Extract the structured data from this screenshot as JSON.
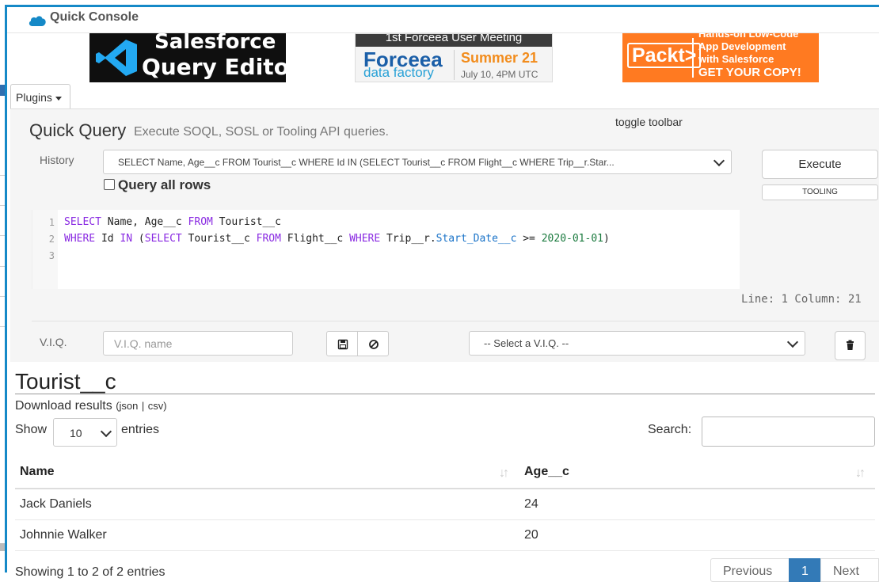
{
  "window": {
    "title": "Quick Console"
  },
  "banners": {
    "editor": {
      "line1": "Salesforce",
      "line2": "Query Editor"
    },
    "forceea": {
      "meeting": "1st Forceea User Meeting",
      "brand": "Forceea",
      "sub": "data factory",
      "season": "Summer 21",
      "date": "July 10, 4PM UTC"
    },
    "packt": {
      "logo": "Packt>",
      "line1": "Hands-on Low-Code",
      "line2": "App Development",
      "line3": "with Salesforce",
      "line4": "GET YOUR COPY!"
    }
  },
  "plugins": {
    "label": "Plugins"
  },
  "quick_query": {
    "title": "Quick Query",
    "description": "Execute SOQL, SOSL or Tooling API queries.",
    "toggle_toolbar": "toggle toolbar",
    "history_label": "History",
    "history_value": "SELECT Name, Age__c FROM Tourist__c WHERE Id IN (SELECT Tourist__c FROM Flight__c WHERE Trip__r.Star...",
    "query_all_rows": "Query all rows",
    "execute": "Execute",
    "tooling": "TOOLING"
  },
  "editor": {
    "line_numbers": [
      "1",
      "2",
      "3"
    ],
    "line1": {
      "kw1": "SELECT",
      "t1": " Name, Age__c ",
      "kw2": "FROM",
      "t2": " Tourist__c"
    },
    "line2": {
      "kw1": "WHERE",
      "t1": " Id ",
      "kw2": "IN",
      "t2": " (",
      "kw3": "SELECT",
      "t3": " Tourist__c ",
      "kw4": "FROM",
      "t4": " Flight__c ",
      "kw5": "WHERE",
      "t5": " Trip__r.",
      "field": "Start_Date__c",
      "t6": " >= ",
      "num": "2020-01-01",
      "t7": ")"
    },
    "status": "Line: 1 Column: 21"
  },
  "viq": {
    "label": "V.I.Q.",
    "name_placeholder": "V.I.Q. name",
    "select_value": "-- Select a V.I.Q. --"
  },
  "results": {
    "title": "Tourist__c",
    "download_label": "Download results",
    "open_paren": "(",
    "json": "json",
    "sep": "|",
    "csv": "csv",
    "close_paren": ")",
    "show_label": "Show",
    "entries_value": "10",
    "entries_label": "entries",
    "search_label": "Search:",
    "columns": [
      "Name",
      "Age__c"
    ],
    "rows": [
      [
        "Jack Daniels",
        "24"
      ],
      [
        "Johnnie Walker",
        "20"
      ]
    ],
    "info": "Showing 1 to 2 of 2 entries",
    "pagination": {
      "previous": "Previous",
      "current": "1",
      "next": "Next"
    }
  },
  "colors": {
    "accent": "#1589c7",
    "pagination_active": "#337ab7",
    "packt_orange": "#ff7a21",
    "keyword": "#8a2be2",
    "field": "#1a73c8",
    "number": "#1a7a3e"
  },
  "icons": [
    "salesforce-cloud-icon",
    "caret-down-icon",
    "chevron-down-icon",
    "save-icon",
    "cancel-icon",
    "trash-icon",
    "sort-icon"
  ]
}
